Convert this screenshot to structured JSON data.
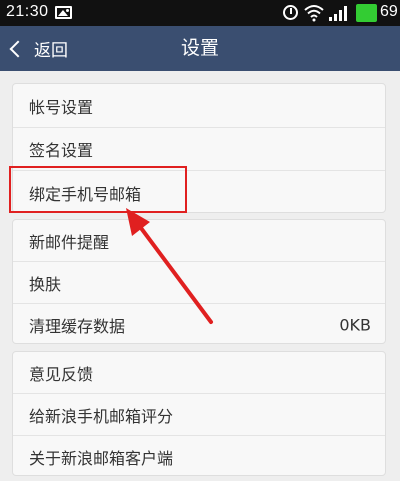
{
  "status_bar": {
    "time": "21:30",
    "battery_level": "69",
    "icons": [
      "image-icon",
      "alarm-icon",
      "wifi-icon",
      "signal-icon",
      "battery-icon"
    ]
  },
  "header": {
    "back_label": "返回",
    "title": "设置"
  },
  "groups": [
    {
      "items": [
        {
          "label": "帐号设置"
        },
        {
          "label": "签名设置"
        },
        {
          "label": "绑定手机号邮箱"
        }
      ]
    },
    {
      "items": [
        {
          "label": "新邮件提醒"
        },
        {
          "label": "换肤"
        },
        {
          "label": "清理缓存数据",
          "value": "0KB"
        }
      ]
    },
    {
      "items": [
        {
          "label": "意见反馈"
        },
        {
          "label": "给新浪手机邮箱评分"
        },
        {
          "label": "关于新浪邮箱客户端"
        }
      ]
    }
  ],
  "annotation": {
    "highlight_color": "#e02020"
  },
  "colors": {
    "header_bg": "#3a4e70",
    "status_bar_bg": "#111111",
    "page_bg": "#eeeeee"
  }
}
